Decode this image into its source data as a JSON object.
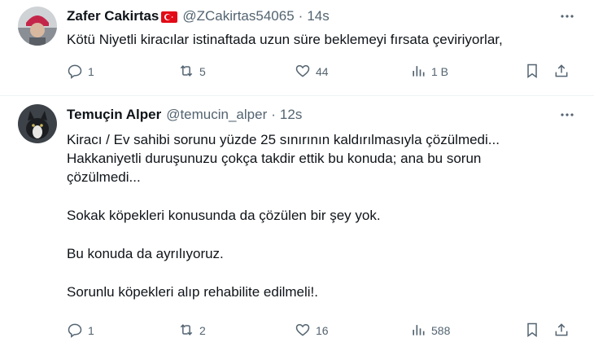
{
  "tweets": [
    {
      "display_name": "Zafer Cakirtas",
      "handle": "@ZCakirtas54065",
      "separator": "·",
      "time": "14s",
      "text_lines": [
        "Kötü Niyetli kiracılar istinaftada uzun süre beklemeyi fırsata çeviriyorlar,"
      ],
      "replies": "1",
      "reposts": "5",
      "likes": "44",
      "views": "1 B",
      "flag_icon": "turkey-flag-icon"
    },
    {
      "display_name": "Temuçin Alper",
      "handle": "@temucin_alper",
      "separator": "·",
      "time": "12s",
      "paragraphs": [
        [
          "Kiracı /  Ev sahibi sorunu yüzde 25 sınırının kaldırılmasıyla çözülmedi...",
          "Hakkaniyetli duruşunuzu çokça takdir ettik bu konuda; ana bu sorun",
          "çözülmedi..."
        ],
        [
          "Sokak köpekleri konusunda da çözülen bir şey yok."
        ],
        [
          "Bu konuda da ayrılıyoruz."
        ],
        [
          "Sorunlu köpekleri alıp rehabilite edilmeli!."
        ]
      ],
      "replies": "1",
      "reposts": "2",
      "likes": "16",
      "views": "588"
    }
  ],
  "colors": {
    "text": "#0f1419",
    "secondary": "#536471",
    "divider": "#eff3f4",
    "flag_red": "#e30a17"
  }
}
